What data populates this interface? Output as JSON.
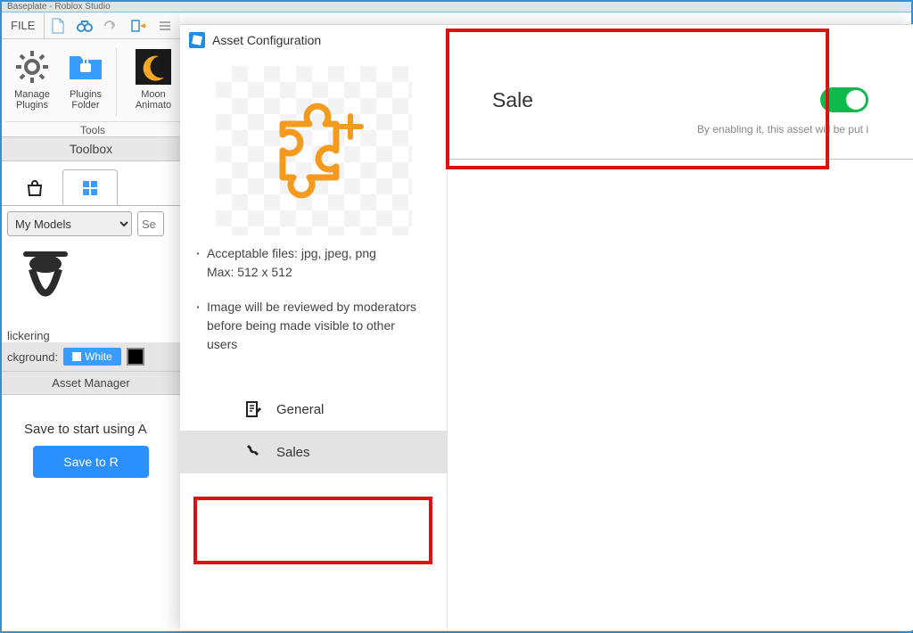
{
  "window": {
    "title": "Baseplate - Roblox Studio"
  },
  "menu": {
    "file": "FILE"
  },
  "ribbon": {
    "buttons": [
      {
        "label": "Manage Plugins"
      },
      {
        "label": "Plugins Folder"
      },
      {
        "label": "Moon Animato"
      }
    ],
    "group_label": "Tools"
  },
  "toolbox": {
    "title": "Toolbox",
    "category_select": "My Models",
    "search_placeholder": "Se",
    "item_label": "lickering",
    "background_label": "ckground:",
    "white_chip": "White"
  },
  "asset_manager": {
    "title": "Asset Manager",
    "hint": "Save to start using A",
    "save_button": "Save to R"
  },
  "modal": {
    "title": "Asset Configuration",
    "hints": {
      "files": "Acceptable files: jpg, jpeg, png",
      "max": "Max: 512 x 512",
      "review": "Image will be reviewed by moderators before being made visible to other users"
    },
    "nav": {
      "general": "General",
      "sales": "Sales"
    }
  },
  "sale_panel": {
    "label": "Sale",
    "subtext": "By enabling it, this asset will be put i",
    "toggle_on": true
  }
}
